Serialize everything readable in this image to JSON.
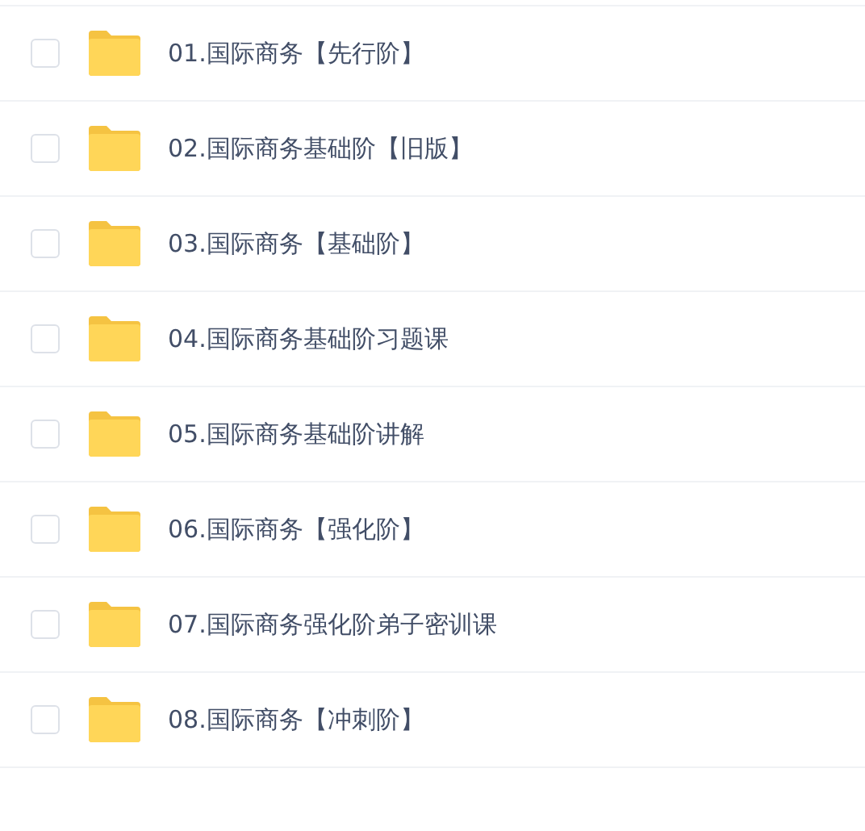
{
  "files": [
    {
      "name": "01.国际商务【先行阶】",
      "checked": false
    },
    {
      "name": "02.国际商务基础阶【旧版】",
      "checked": false
    },
    {
      "name": "03.国际商务【基础阶】",
      "checked": false
    },
    {
      "name": "04.国际商务基础阶习题课",
      "checked": false
    },
    {
      "name": "05.国际商务基础阶讲解",
      "checked": false
    },
    {
      "name": "06.国际商务【强化阶】",
      "checked": false
    },
    {
      "name": "07.国际商务强化阶弟子密训课",
      "checked": false
    },
    {
      "name": "08.国际商务【冲刺阶】",
      "checked": false
    }
  ]
}
